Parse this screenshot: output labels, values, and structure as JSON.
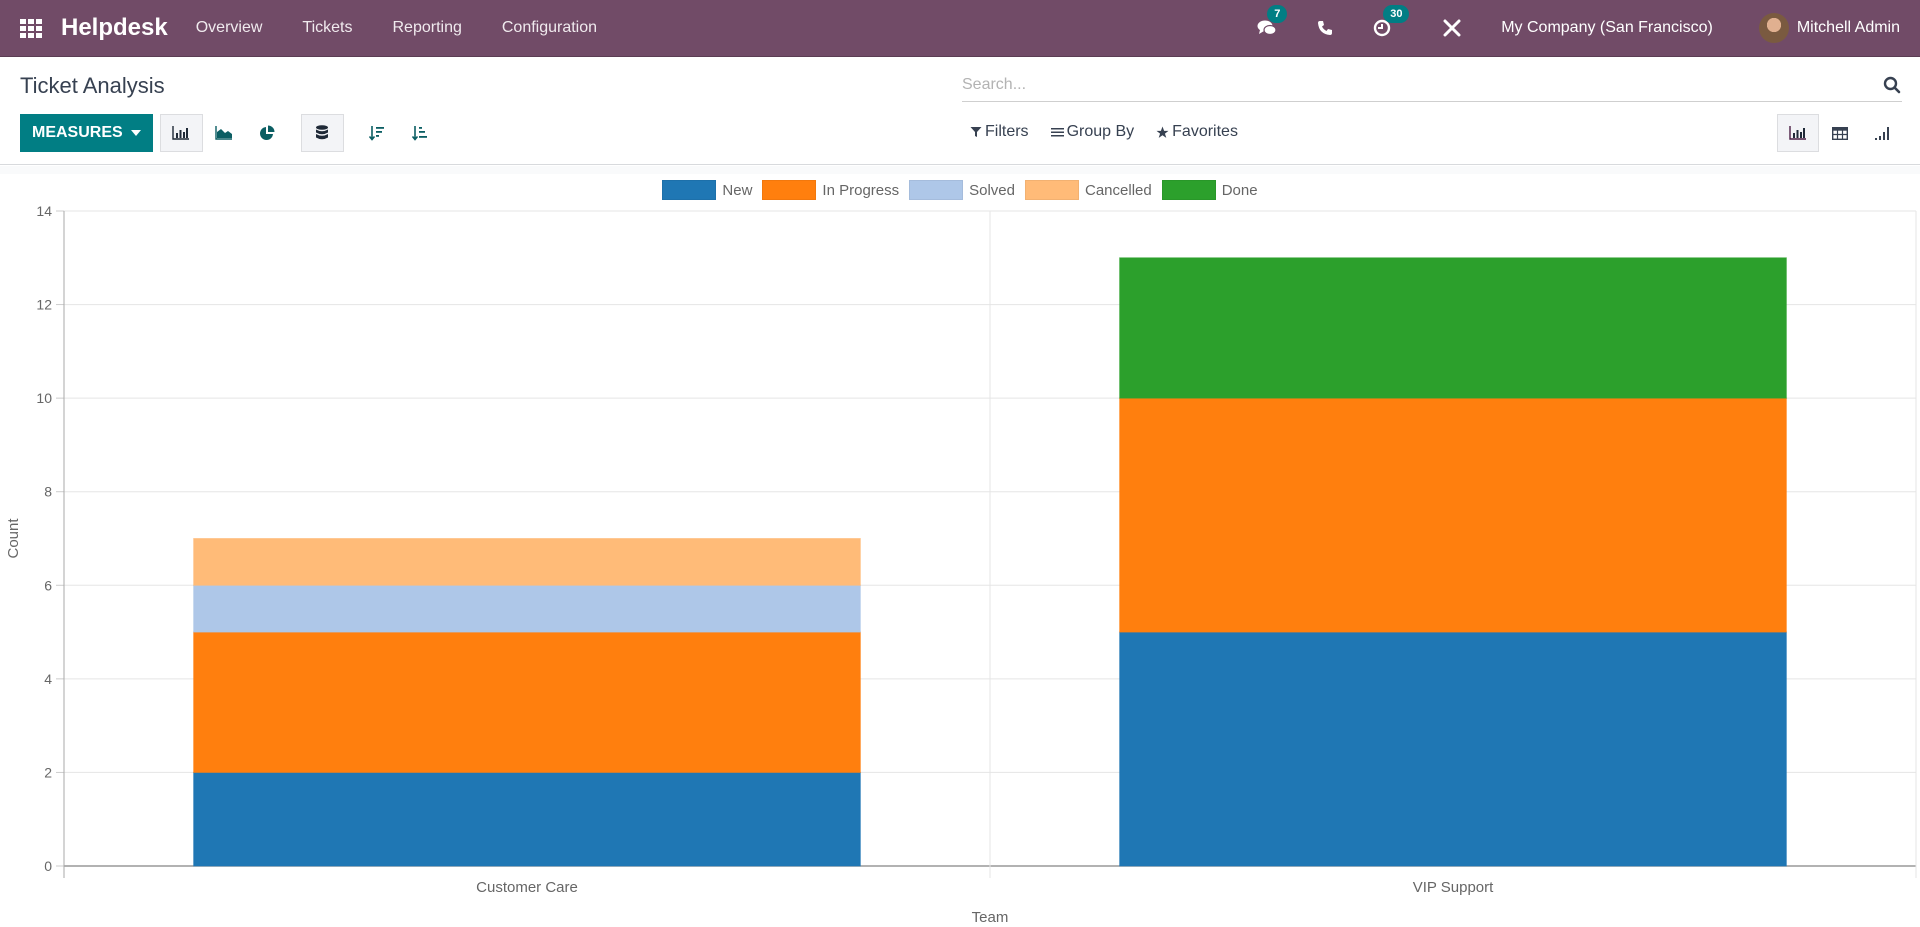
{
  "navbar": {
    "brand": "Helpdesk",
    "menus": [
      "Overview",
      "Tickets",
      "Reporting",
      "Configuration"
    ],
    "messages_badge": "7",
    "activities_badge": "30",
    "company": "My Company (San Francisco)",
    "user": "Mitchell Admin"
  },
  "control_panel": {
    "title": "Ticket Analysis",
    "search_placeholder": "Search...",
    "measures_label": "MEASURES",
    "filters_label": "Filters",
    "groupby_label": "Group By",
    "favorites_label": "Favorites"
  },
  "colors": {
    "brand": "#714B67",
    "accent": "#017e84"
  },
  "chart_data": {
    "type": "bar",
    "stacked": true,
    "title": "",
    "xlabel": "Team",
    "ylabel": "Count",
    "ylim": [
      0,
      14
    ],
    "yticks": [
      0,
      2,
      4,
      6,
      8,
      10,
      12,
      14
    ],
    "grid": true,
    "legend_position": "top-center",
    "categories": [
      "Customer Care",
      "VIP Support"
    ],
    "series": [
      {
        "name": "New",
        "color": "#1f77b4",
        "values": [
          2,
          5
        ]
      },
      {
        "name": "In Progress",
        "color": "#ff7f0e",
        "values": [
          3,
          5
        ]
      },
      {
        "name": "Solved",
        "color": "#aec7e8",
        "values": [
          1,
          0
        ]
      },
      {
        "name": "Cancelled",
        "color": "#ffbb78",
        "values": [
          1,
          0
        ]
      },
      {
        "name": "Done",
        "color": "#2ca02c",
        "values": [
          0,
          3
        ]
      }
    ]
  }
}
